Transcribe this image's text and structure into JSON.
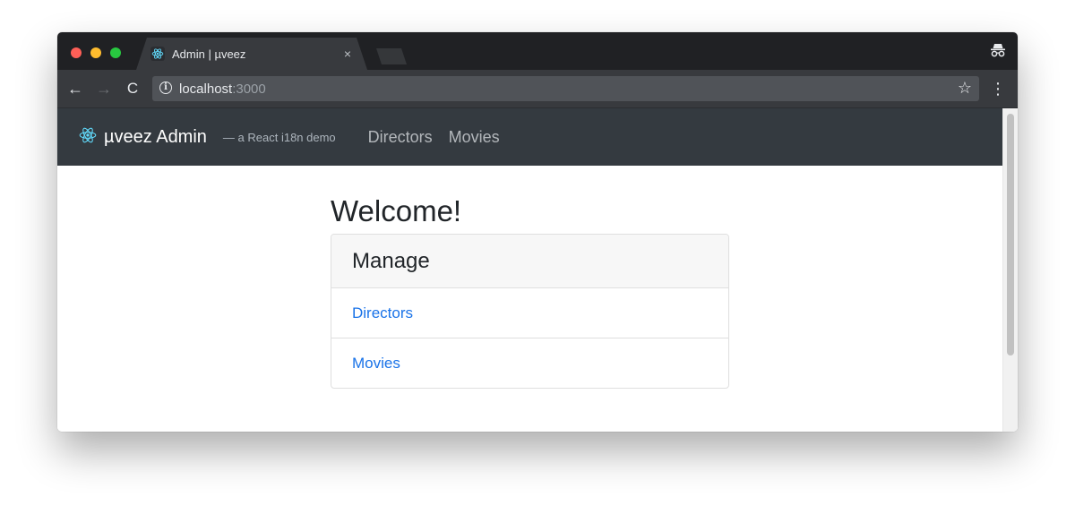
{
  "browser": {
    "tab": {
      "title": "Admin | µveez",
      "close": "×"
    },
    "address": {
      "host": "localhost",
      "port": ":3000"
    },
    "icons": {
      "back": "arrow-left-icon",
      "forward": "arrow-right-icon",
      "reload": "reload-icon",
      "info": "info-icon",
      "star": "star-icon",
      "menu": "kebab-menu-icon",
      "incognito": "incognito-icon",
      "favicon": "react-atom-icon"
    },
    "glyphs": {
      "back": "←",
      "forward": "→",
      "reload": "C",
      "info": "i",
      "star": "☆",
      "menu": "⋮"
    }
  },
  "app": {
    "brand": "µveez Admin",
    "tagline": "— a React i18n demo",
    "nav": [
      {
        "label": "Directors"
      },
      {
        "label": "Movies"
      }
    ],
    "colors": {
      "navbar": "#343a40",
      "react": "#61dafb",
      "link": "#1a73e8"
    }
  },
  "main": {
    "heading": "Welcome!",
    "card": {
      "header": "Manage",
      "items": [
        {
          "label": "Directors"
        },
        {
          "label": "Movies"
        }
      ]
    }
  }
}
